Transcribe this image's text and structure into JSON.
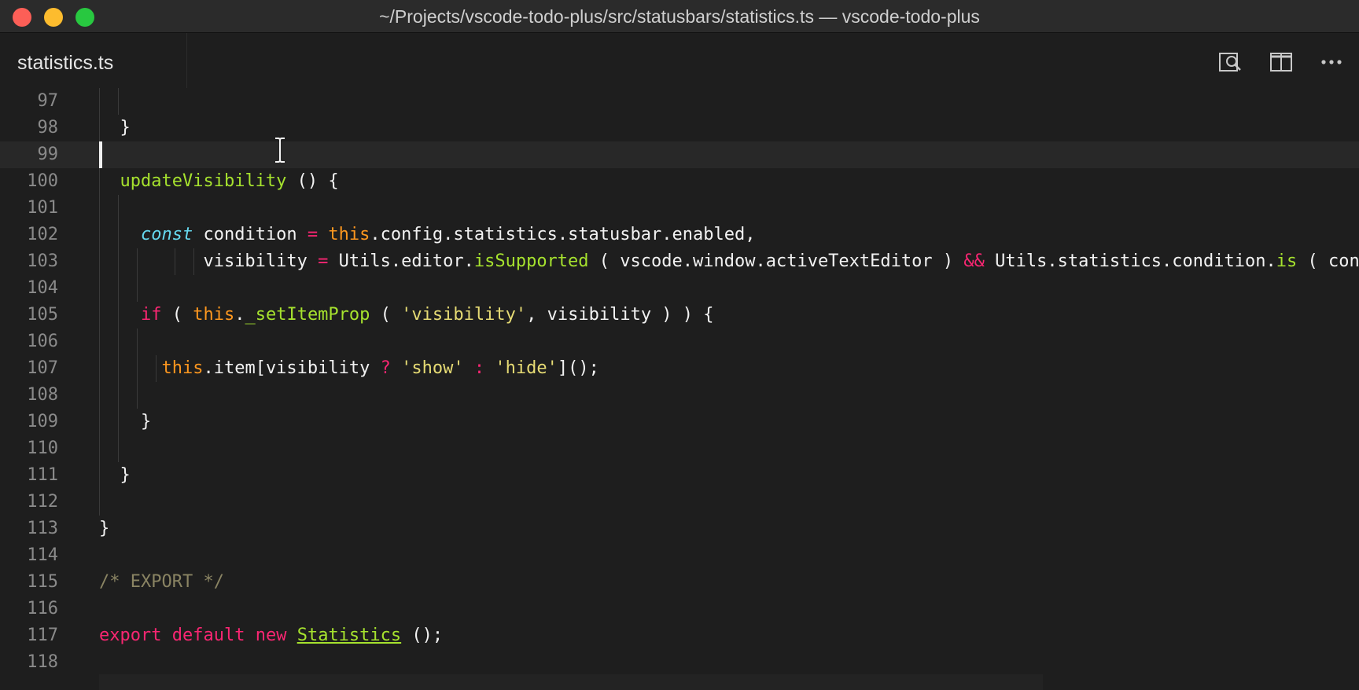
{
  "window": {
    "title": "~/Projects/vscode-todo-plus/src/statusbars/statistics.ts — vscode-todo-plus",
    "traffic_lights": [
      "close",
      "minimize",
      "maximize"
    ],
    "colors": {
      "close": "#fc5f57",
      "minimize": "#fdbc2e",
      "maximize": "#28c840"
    }
  },
  "tabbar": {
    "active_tab": "statistics.ts",
    "actions": [
      "search-icon",
      "split-editor-icon",
      "more-icon"
    ]
  },
  "editor": {
    "current_line": "99",
    "lines": [
      {
        "num": "97",
        "tokens": []
      },
      {
        "num": "98",
        "tokens": [
          {
            "t": "  }",
            "c": "pl"
          }
        ]
      },
      {
        "num": "99",
        "tokens": []
      },
      {
        "num": "100",
        "tokens": [
          {
            "t": "  ",
            "c": "pl"
          },
          {
            "t": "updateVisibility",
            "c": "fn"
          },
          {
            "t": " () {",
            "c": "pl"
          }
        ]
      },
      {
        "num": "101",
        "tokens": []
      },
      {
        "num": "102",
        "tokens": [
          {
            "t": "    ",
            "c": "pl"
          },
          {
            "t": "const",
            "c": "storage"
          },
          {
            "t": " condition ",
            "c": "pl"
          },
          {
            "t": "=",
            "c": "op"
          },
          {
            "t": " ",
            "c": "pl"
          },
          {
            "t": "this",
            "c": "this"
          },
          {
            "t": ".config.statistics.statusbar.enabled,",
            "c": "pl"
          }
        ]
      },
      {
        "num": "103",
        "tokens": [
          {
            "t": "          visibility ",
            "c": "pl"
          },
          {
            "t": "=",
            "c": "op"
          },
          {
            "t": " Utils.editor.",
            "c": "pl"
          },
          {
            "t": "isSupported",
            "c": "fn"
          },
          {
            "t": " ( vscode.window.activeTextEditor ) ",
            "c": "pl"
          },
          {
            "t": "&&",
            "c": "op"
          },
          {
            "t": " Utils.statistics.condition.",
            "c": "pl"
          },
          {
            "t": "is",
            "c": "fn"
          },
          {
            "t": " ( con",
            "c": "pl"
          }
        ]
      },
      {
        "num": "104",
        "tokens": []
      },
      {
        "num": "105",
        "tokens": [
          {
            "t": "    ",
            "c": "pl"
          },
          {
            "t": "if",
            "c": "kw"
          },
          {
            "t": " ( ",
            "c": "pl"
          },
          {
            "t": "this",
            "c": "this"
          },
          {
            "t": ".",
            "c": "pl"
          },
          {
            "t": "_setItemProp",
            "c": "fn"
          },
          {
            "t": " ( ",
            "c": "pl"
          },
          {
            "t": "'visibility'",
            "c": "str"
          },
          {
            "t": ", visibility ) ) {",
            "c": "pl"
          }
        ]
      },
      {
        "num": "106",
        "tokens": []
      },
      {
        "num": "107",
        "tokens": [
          {
            "t": "      ",
            "c": "pl"
          },
          {
            "t": "this",
            "c": "this"
          },
          {
            "t": ".item[visibility ",
            "c": "pl"
          },
          {
            "t": "?",
            "c": "op"
          },
          {
            "t": " ",
            "c": "pl"
          },
          {
            "t": "'show'",
            "c": "str"
          },
          {
            "t": " ",
            "c": "pl"
          },
          {
            "t": ":",
            "c": "op"
          },
          {
            "t": " ",
            "c": "pl"
          },
          {
            "t": "'hide'",
            "c": "str"
          },
          {
            "t": "]();",
            "c": "pl"
          }
        ]
      },
      {
        "num": "108",
        "tokens": []
      },
      {
        "num": "109",
        "tokens": [
          {
            "t": "    }",
            "c": "pl"
          }
        ]
      },
      {
        "num": "110",
        "tokens": []
      },
      {
        "num": "111",
        "tokens": [
          {
            "t": "  }",
            "c": "pl"
          }
        ]
      },
      {
        "num": "112",
        "tokens": []
      },
      {
        "num": "113",
        "tokens": [
          {
            "t": "}",
            "c": "pl"
          }
        ]
      },
      {
        "num": "114",
        "tokens": []
      },
      {
        "num": "115",
        "tokens": [
          {
            "t": "/* EXPORT */",
            "c": "cm"
          }
        ]
      },
      {
        "num": "116",
        "tokens": []
      },
      {
        "num": "117",
        "tokens": [
          {
            "t": "export",
            "c": "kw"
          },
          {
            "t": " ",
            "c": "pl"
          },
          {
            "t": "default",
            "c": "kw"
          },
          {
            "t": " ",
            "c": "pl"
          },
          {
            "t": "new",
            "c": "kw"
          },
          {
            "t": " ",
            "c": "pl"
          },
          {
            "t": "Statistics",
            "c": "fnu"
          },
          {
            "t": " ();",
            "c": "pl"
          }
        ]
      },
      {
        "num": "118",
        "tokens": []
      }
    ]
  }
}
